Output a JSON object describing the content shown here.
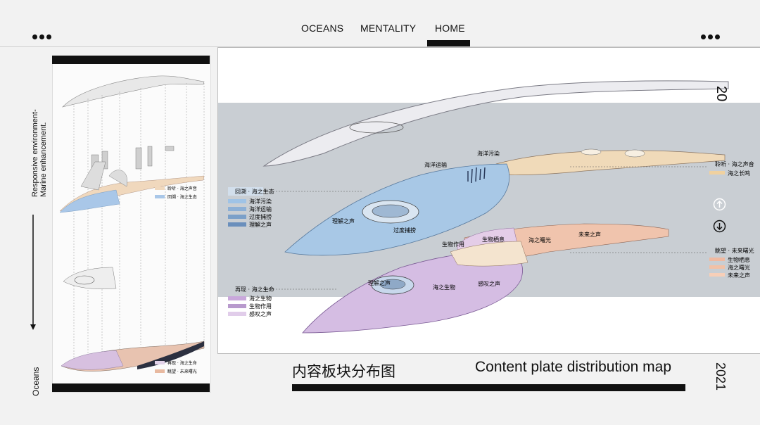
{
  "header": {
    "nav": [
      "OCEANS",
      "MENTALITY",
      "HOME"
    ],
    "active": "HOME",
    "left_dots_icon": "more-dots-icon",
    "right_dots_icon": "more-dots-icon"
  },
  "side": {
    "vertical_title": "Responsive environment-Marine enhancement.",
    "vertical_bottom": "Oceans",
    "arrow_icon": "arrow-down-icon"
  },
  "right_side": {
    "page_number": "20",
    "year": "2021",
    "up_icon": "arrow-up-circle-icon",
    "down_icon": "arrow-down-circle-icon"
  },
  "left_panel": {
    "legend_top": [
      "聆听 · 海之声音",
      "回溯 · 海之生态"
    ],
    "legend_bottom": [
      "再现 · 海之生命",
      "眺望 · 未来曙光"
    ]
  },
  "main": {
    "labels": {
      "ocean_transport": "海洋运输",
      "ocean_pollution": "海洋污染",
      "understand_voice": "理解之声",
      "overfishing": "过度捕捞",
      "bio_habitat": "生物栖息",
      "bio_function": "生物作用",
      "sea_dawn": "海之曙光",
      "future_voice": "未来之声",
      "sea_life": "海之生物",
      "feel_voice": "感叹之声",
      "understand_voice2": "理解之声"
    },
    "legend_ecology": {
      "title": "回溯 · 海之生态",
      "items": [
        "海洋污染",
        "海洋运输",
        "过度捕捞",
        "理解之声"
      ]
    },
    "legend_life": {
      "title": "再现 · 海之生命",
      "items": [
        "海之生物",
        "生物作用",
        "感叹之声"
      ]
    },
    "legend_sound": {
      "title": "聆听 · 海之声音",
      "items": [
        "海之长鸣"
      ]
    },
    "legend_future": {
      "title": "眺望 · 未来曙光",
      "items": [
        "生物栖息",
        "海之曙光",
        "未来之声"
      ]
    }
  },
  "footer": {
    "title_cn": "内容板块分布图",
    "title_en": "Content plate distribution map"
  },
  "colors": {
    "blue": "#9fc3e6",
    "orange": "#e9c9a2",
    "purple": "#cfb3dc",
    "peach": "#e8b9a0"
  }
}
